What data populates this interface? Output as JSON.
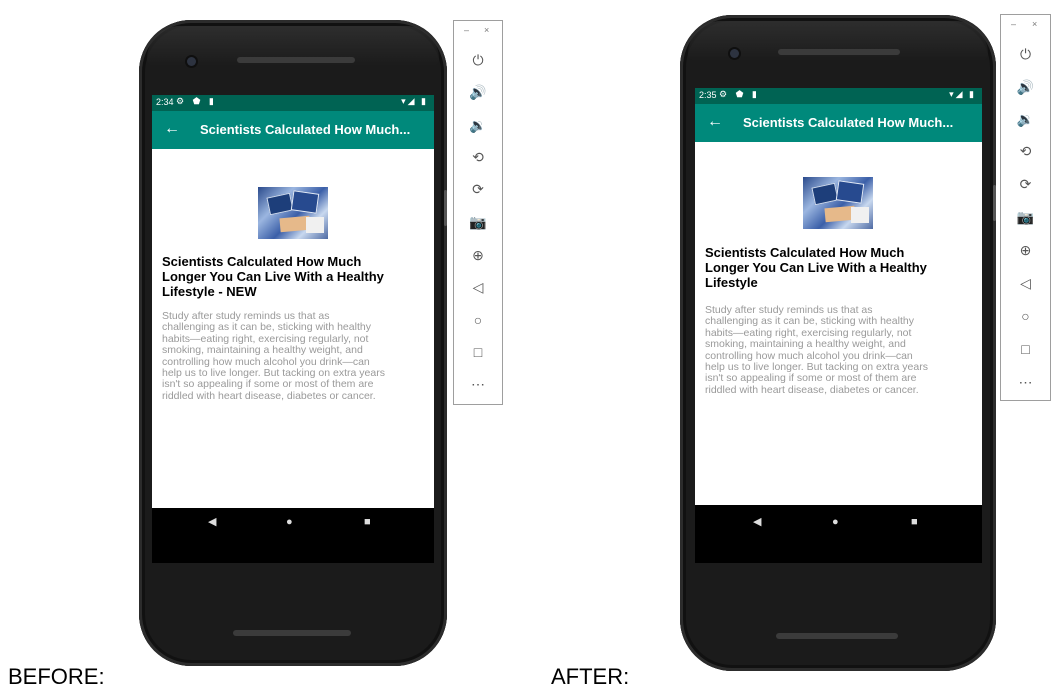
{
  "labels": {
    "before": "BEFORE:",
    "after": "AFTER:"
  },
  "before": {
    "status_time": "2:34",
    "status_left_icons": "⚙ ⬟ ▮",
    "status_right_icons": "▾◢ ▮",
    "appbar_back": "←",
    "appbar_title": "Scientists Calculated How Much...",
    "headline_1": "Scientists Calculated How Much",
    "headline_2": "Longer You Can Live With a Healthy",
    "headline_3": "Lifestyle - NEW",
    "body_lines": [
      "Study after study reminds us that as",
      "challenging as it can be, sticking with healthy",
      "habits—eating right, exercising regularly, not",
      "smoking, maintaining a healthy weight, and",
      "controlling how much alcohol you drink—can",
      "help us to live longer. But tacking on extra years",
      "isn't so appealing if some or most of them are",
      "riddled with heart disease, diabetes or cancer."
    ],
    "nav_back": "◀",
    "nav_home": "●",
    "nav_recent": "■"
  },
  "after": {
    "status_time": "2:35",
    "status_left_icons": "⚙ ⬟ ▮",
    "status_right_icons": "▾◢ ▮",
    "appbar_back": "←",
    "appbar_title": "Scientists Calculated How Much...",
    "headline_1": "Scientists Calculated How Much",
    "headline_2": "Longer You Can Live With a Healthy",
    "headline_3": "Lifestyle",
    "body_lines": [
      "Study after study reminds us that as",
      "challenging as it can be, sticking with healthy",
      "habits—eating right, exercising regularly, not",
      "smoking, maintaining a healthy weight, and",
      "controlling how much alcohol you drink—can",
      "help us to live longer. But tacking on extra years",
      "isn't so appealing if some or most of them are",
      "riddled with heart disease, diabetes or cancer."
    ],
    "nav_back": "◀",
    "nav_home": "●",
    "nav_recent": "■"
  },
  "emulator": {
    "minimize": "–",
    "close": "×",
    "icons": [
      "⏻",
      "🔊",
      "🔉",
      "⟲",
      "⟳",
      "📷",
      "⊕",
      "◁",
      "○",
      "□",
      "⋯"
    ],
    "icon_names": [
      "power-icon",
      "volume-up-icon",
      "volume-down-icon",
      "rotate-left-icon",
      "rotate-right-icon",
      "camera-icon",
      "zoom-icon",
      "back-icon",
      "home-icon",
      "overview-icon",
      "more-icon"
    ]
  }
}
